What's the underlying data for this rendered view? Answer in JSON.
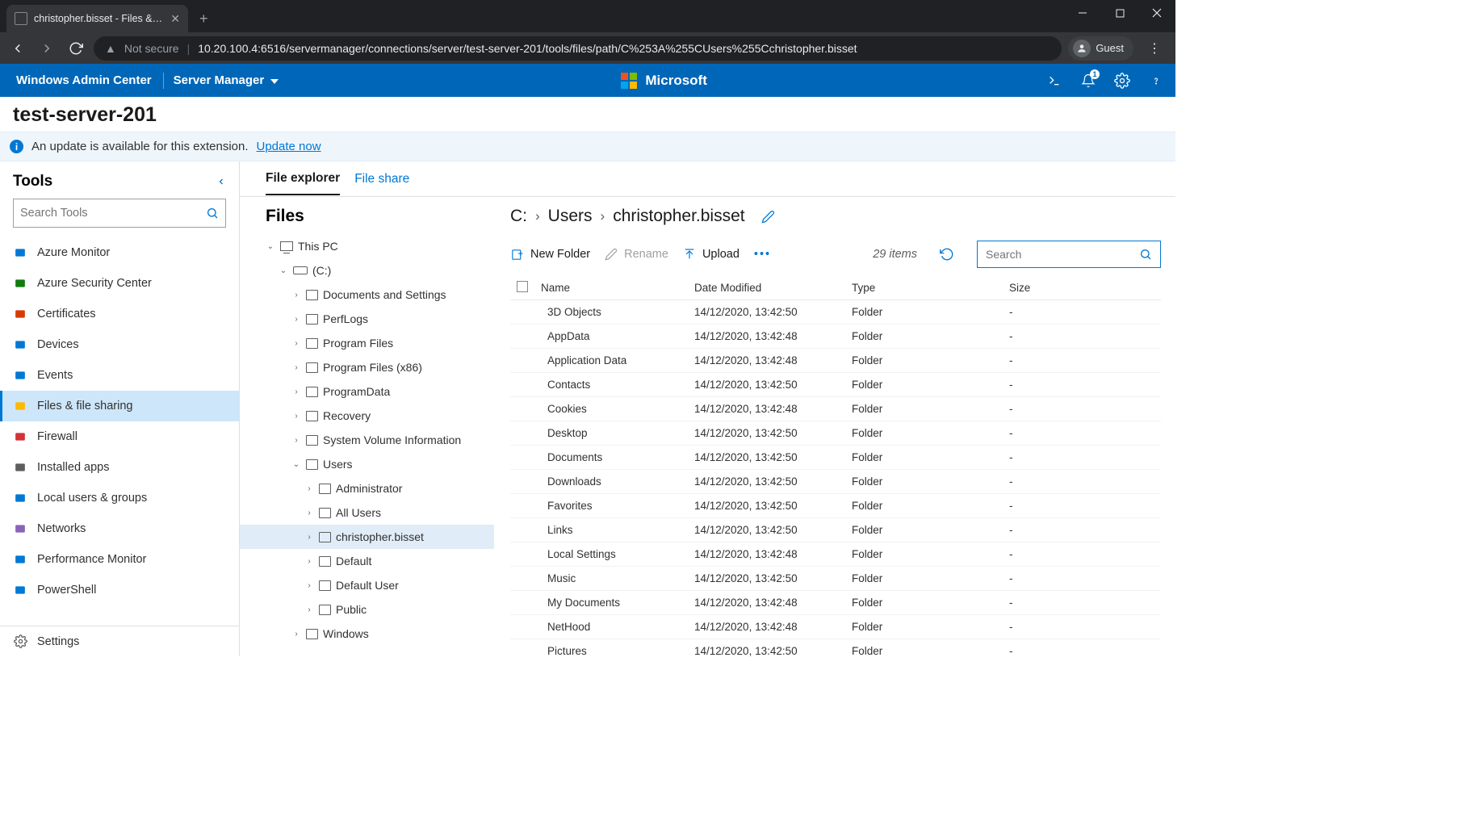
{
  "browser": {
    "tab_title": "christopher.bisset - Files & file sh",
    "url_insecure": "Not secure",
    "url": "10.20.100.4:6516/servermanager/connections/server/test-server-201/tools/files/path/C%253A%255CUsers%255Cchristopher.bisset",
    "guest_label": "Guest"
  },
  "header": {
    "app_title": "Windows Admin Center",
    "context": "Server Manager",
    "ms_label": "Microsoft",
    "notification_count": "1"
  },
  "server_name": "test-server-201",
  "banner": {
    "text": "An update is available for this extension.",
    "link": "Update now"
  },
  "tools_title": "Tools",
  "tools_search_placeholder": "Search Tools",
  "tools": [
    {
      "label": "Azure Monitor",
      "color": "#0078d4",
      "active": false
    },
    {
      "label": "Azure Security Center",
      "color": "#107c10",
      "active": false
    },
    {
      "label": "Certificates",
      "color": "#d83b01",
      "active": false
    },
    {
      "label": "Devices",
      "color": "#0078d4",
      "active": false
    },
    {
      "label": "Events",
      "color": "#0078d4",
      "active": false
    },
    {
      "label": "Files & file sharing",
      "color": "#ffb900",
      "active": true
    },
    {
      "label": "Firewall",
      "color": "#d13438",
      "active": false
    },
    {
      "label": "Installed apps",
      "color": "#605e5c",
      "active": false
    },
    {
      "label": "Local users & groups",
      "color": "#0078d4",
      "active": false
    },
    {
      "label": "Networks",
      "color": "#8764b8",
      "active": false
    },
    {
      "label": "Performance Monitor",
      "color": "#0078d4",
      "active": false
    },
    {
      "label": "PowerShell",
      "color": "#0078d4",
      "active": false
    }
  ],
  "settings_label": "Settings",
  "content_tabs": {
    "explorer": "File explorer",
    "share": "File share"
  },
  "tree_title": "Files",
  "tree": {
    "root": "This PC",
    "drive": "(C:)",
    "drive_children": [
      "Documents and Settings",
      "PerfLogs",
      "Program Files",
      "Program Files (x86)",
      "ProgramData",
      "Recovery",
      "System Volume Information"
    ],
    "users_label": "Users",
    "users_children": [
      "Administrator",
      "All Users",
      "christopher.bisset",
      "Default",
      "Default User",
      "Public"
    ],
    "windows_label": "Windows"
  },
  "breadcrumb": [
    "C:",
    "Users",
    "christopher.bisset"
  ],
  "toolbar": {
    "new_folder": "New Folder",
    "rename": "Rename",
    "upload": "Upload",
    "item_count": "29 items",
    "search_placeholder": "Search"
  },
  "columns": {
    "name": "Name",
    "date": "Date Modified",
    "type": "Type",
    "size": "Size"
  },
  "files": [
    {
      "name": "3D Objects",
      "date": "14/12/2020, 13:42:50",
      "type": "Folder",
      "size": "-"
    },
    {
      "name": "AppData",
      "date": "14/12/2020, 13:42:48",
      "type": "Folder",
      "size": "-"
    },
    {
      "name": "Application Data",
      "date": "14/12/2020, 13:42:48",
      "type": "Folder",
      "size": "-"
    },
    {
      "name": "Contacts",
      "date": "14/12/2020, 13:42:50",
      "type": "Folder",
      "size": "-"
    },
    {
      "name": "Cookies",
      "date": "14/12/2020, 13:42:48",
      "type": "Folder",
      "size": "-"
    },
    {
      "name": "Desktop",
      "date": "14/12/2020, 13:42:50",
      "type": "Folder",
      "size": "-"
    },
    {
      "name": "Documents",
      "date": "14/12/2020, 13:42:50",
      "type": "Folder",
      "size": "-"
    },
    {
      "name": "Downloads",
      "date": "14/12/2020, 13:42:50",
      "type": "Folder",
      "size": "-"
    },
    {
      "name": "Favorites",
      "date": "14/12/2020, 13:42:50",
      "type": "Folder",
      "size": "-"
    },
    {
      "name": "Links",
      "date": "14/12/2020, 13:42:50",
      "type": "Folder",
      "size": "-"
    },
    {
      "name": "Local Settings",
      "date": "14/12/2020, 13:42:48",
      "type": "Folder",
      "size": "-"
    },
    {
      "name": "Music",
      "date": "14/12/2020, 13:42:50",
      "type": "Folder",
      "size": "-"
    },
    {
      "name": "My Documents",
      "date": "14/12/2020, 13:42:48",
      "type": "Folder",
      "size": "-"
    },
    {
      "name": "NetHood",
      "date": "14/12/2020, 13:42:48",
      "type": "Folder",
      "size": "-"
    },
    {
      "name": "Pictures",
      "date": "14/12/2020, 13:42:50",
      "type": "Folder",
      "size": "-"
    }
  ]
}
